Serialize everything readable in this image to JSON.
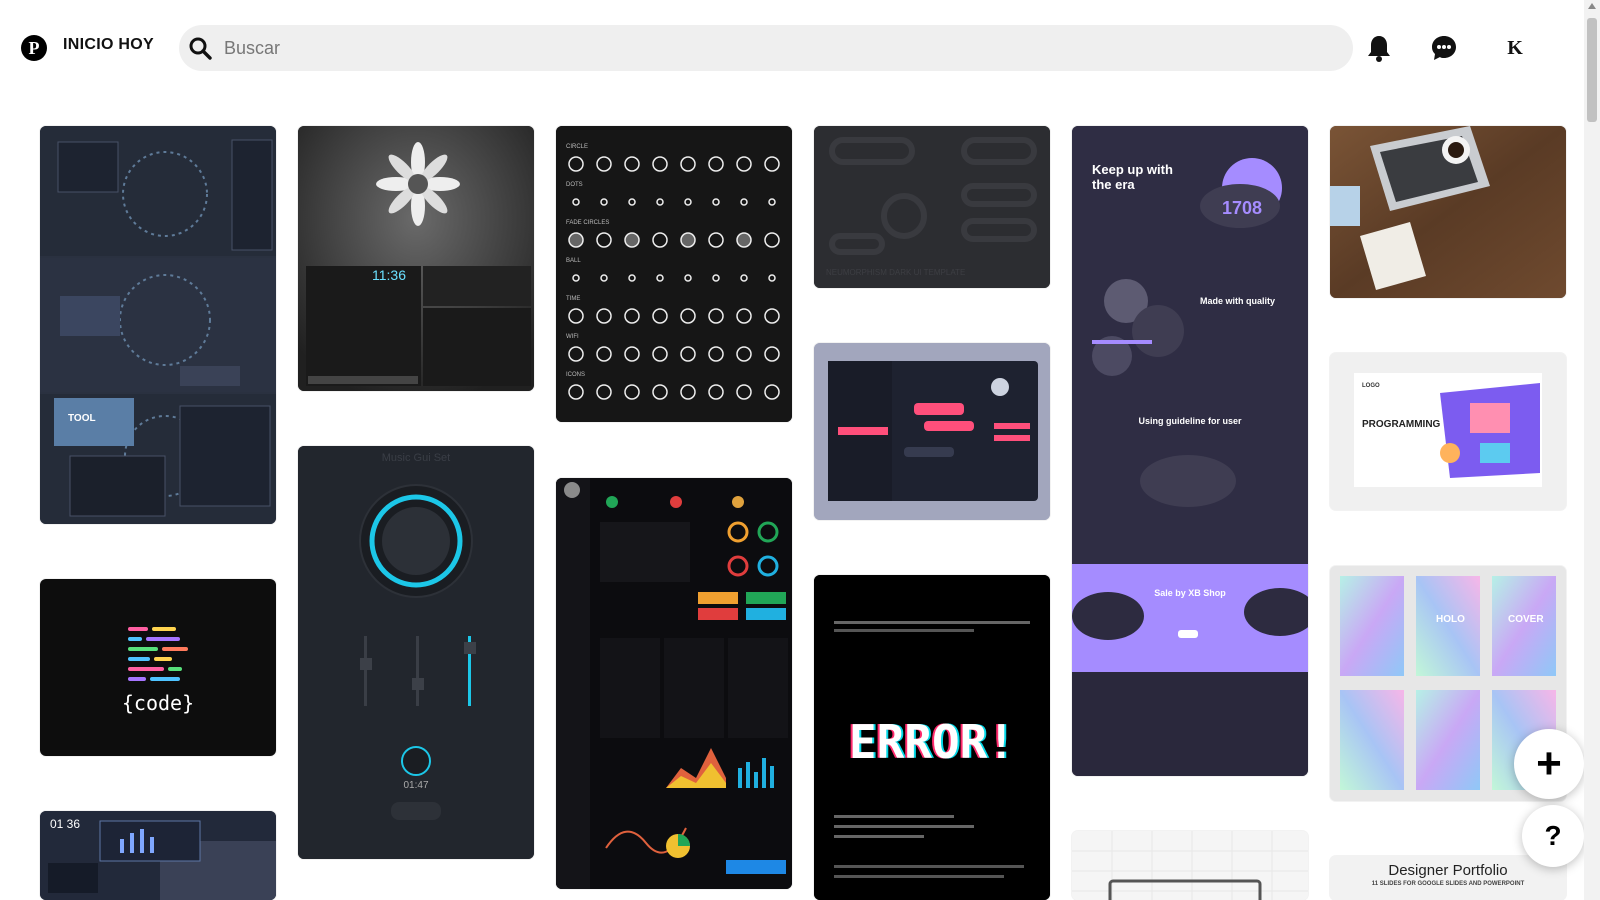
{
  "header": {
    "logo_text": "P",
    "home_link": "INICIO HOY",
    "search_placeholder": "Buscar",
    "avatar_initial": "K"
  },
  "icons": {
    "logo": "pinterest-logo-icon",
    "search": "search-icon",
    "notifications": "bell-icon",
    "messages": "chat-icon"
  },
  "feed": {
    "pins": [
      {
        "name": "dark-desktop-theme-collage",
        "text": "TOOL"
      },
      {
        "name": "grayscale-flower-desktop",
        "text": "11:36"
      },
      {
        "name": "loading-icons-sheet",
        "labels": [
          "CIRCLE",
          "DOTS",
          "FADE CIRCLES",
          "BALL",
          "TIME",
          "WIFI",
          "ICONS"
        ]
      },
      {
        "name": "neumorphic-wireframe",
        "text": "NEUMORPHISM DARK UI TEMPLATE"
      },
      {
        "name": "controller-shop-landing",
        "labels": [
          "Keep up with the era",
          "Made with quality",
          "Using guideline for user",
          "Sale by XB Shop",
          "1708"
        ]
      },
      {
        "name": "desk-laptop-coffee"
      },
      {
        "name": "music-player-knob",
        "labels": [
          "Music Gui Set",
          "01:47"
        ]
      },
      {
        "name": "chat-dashboard-ui"
      },
      {
        "name": "programming-illustration-landing",
        "labels": [
          "LOGO",
          "PROGRAMMING"
        ]
      },
      {
        "name": "code-logo",
        "text": "{code}"
      },
      {
        "name": "dark-analytics-dashboard"
      },
      {
        "name": "error-glitch-poster",
        "text": "ERROR!"
      },
      {
        "name": "holographic-posters",
        "labels": [
          "HOLO",
          "COVER"
        ]
      },
      {
        "name": "dark-lockscreen-theme",
        "text": "01 36"
      },
      {
        "name": "monitor-mockup"
      },
      {
        "name": "designer-portfolio-slides",
        "labels": [
          "Designer Portfolio",
          "11 SLIDES FOR GOOGLE SLIDES AND POWERPOINT"
        ]
      }
    ]
  },
  "fab": {
    "create_label": "+",
    "help_label": "?"
  },
  "colors": {
    "accent_red": "#e60023",
    "search_bg": "#efefef",
    "controller_purple": "#a58cff"
  }
}
